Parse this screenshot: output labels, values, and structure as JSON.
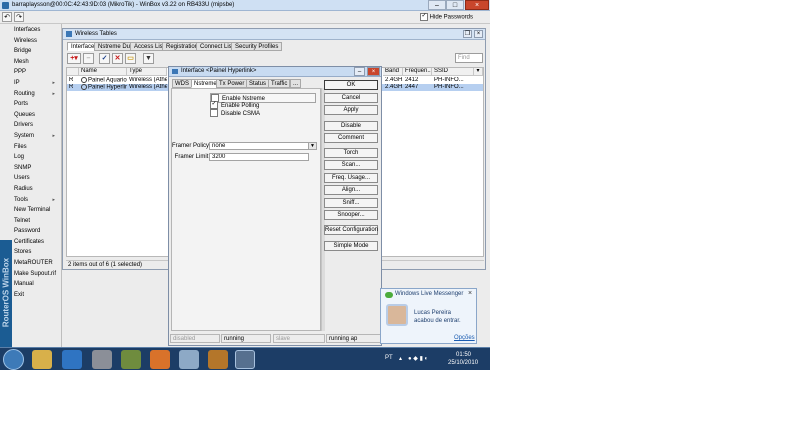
{
  "window": {
    "title": "barraplaysson@00:0C:42:43:9D:03 (MikroTik) - WinBox v3.22 on RB433U (mipsbe)"
  },
  "toolbar": {
    "hide_passwords_label": "Hide Passwords",
    "hide_passwords_checked": true
  },
  "sidebar": {
    "brand": "RouterOS WinBox",
    "items": [
      {
        "label": "Interfaces",
        "submenu": false
      },
      {
        "label": "Wireless",
        "submenu": false
      },
      {
        "label": "Bridge",
        "submenu": false
      },
      {
        "label": "Mesh",
        "submenu": false
      },
      {
        "label": "PPP",
        "submenu": false
      },
      {
        "label": "IP",
        "submenu": true
      },
      {
        "label": "Routing",
        "submenu": true
      },
      {
        "label": "Ports",
        "submenu": false
      },
      {
        "label": "Queues",
        "submenu": false
      },
      {
        "label": "Drivers",
        "submenu": false
      },
      {
        "label": "System",
        "submenu": true
      },
      {
        "label": "Files",
        "submenu": false
      },
      {
        "label": "Log",
        "submenu": false
      },
      {
        "label": "SNMP",
        "submenu": false
      },
      {
        "label": "Users",
        "submenu": false
      },
      {
        "label": "Radius",
        "submenu": false
      },
      {
        "label": "Tools",
        "submenu": true
      },
      {
        "label": "New Terminal",
        "submenu": false
      },
      {
        "label": "Telnet",
        "submenu": false
      },
      {
        "label": "Password",
        "submenu": false
      },
      {
        "label": "Certificates",
        "submenu": false
      },
      {
        "label": "Stores",
        "submenu": false
      },
      {
        "label": "MetaROUTER",
        "submenu": false
      },
      {
        "label": "Make Supout.rif",
        "submenu": false
      },
      {
        "label": "Manual",
        "submenu": false
      },
      {
        "label": "Exit",
        "submenu": false
      }
    ]
  },
  "wireless_tables": {
    "title": "Wireless Tables",
    "tabs": [
      "Interfaces",
      "Nstreme Dual",
      "Access List",
      "Registration",
      "Connect List",
      "Security Profiles"
    ],
    "find_placeholder": "Find",
    "columns": [
      "Name",
      "Type",
      "Band",
      "Frequen...",
      "SSID"
    ],
    "rows": [
      {
        "flag": "R",
        "name": "Painel Aquario",
        "type": "Wireless (Atheros",
        "band": "2.4GH...",
        "freq": "2412",
        "ssid": "PH-INFO..."
      },
      {
        "flag": "R",
        "name": "Painel Hyperlink",
        "type": "Wireless (Atheros",
        "band": "2.4GH...",
        "freq": "2447",
        "ssid": "PH-INFO..."
      }
    ],
    "status": "2 items out of 6 (1 selected)"
  },
  "dialog": {
    "title": "Interface <Painel Hyperlink>",
    "tabs": [
      "WDS",
      "Nstreme",
      "Tx Power",
      "Status",
      "Traffic",
      "..."
    ],
    "active_tab": "Nstreme",
    "checkboxes": [
      {
        "label": "Enable Nstreme",
        "checked": false
      },
      {
        "label": "Enable Polling",
        "checked": true
      },
      {
        "label": "Disable CSMA",
        "checked": false
      }
    ],
    "framer_policy_label": "Framer Policy:",
    "framer_policy_value": "none",
    "framer_limit_label": "Framer Limit:",
    "framer_limit_value": "3200",
    "buttons": [
      "OK",
      "Cancel",
      "Apply",
      "Disable",
      "Comment",
      "Torch",
      "Scan...",
      "Freq. Usage...",
      "Align...",
      "Sniff...",
      "Snooper...",
      "Reset Configuration",
      "Simple Mode"
    ],
    "status": [
      "disabled",
      "running",
      "slave",
      "running ap"
    ]
  },
  "notification": {
    "app": "Windows Live Messenger",
    "name": "Lucas Pereira",
    "message": "acabou de entrar.",
    "link": "Opções"
  },
  "taskbar": {
    "lang": "PT",
    "time": "01:50",
    "date": "25/10/2010"
  }
}
